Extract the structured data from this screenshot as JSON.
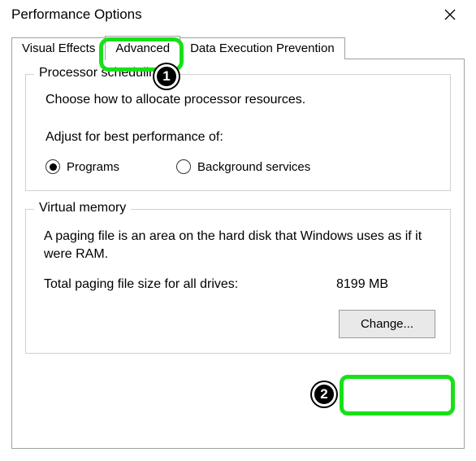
{
  "window": {
    "title": "Performance Options"
  },
  "tabs": {
    "visual_effects": "Visual Effects",
    "advanced": "Advanced",
    "dep": "Data Execution Prevention"
  },
  "processor": {
    "group_title": "Processor scheduling",
    "desc": "Choose how to allocate processor resources.",
    "adjust_label": "Adjust for best performance of:",
    "option_programs": "Programs",
    "option_background": "Background services"
  },
  "virtual_memory": {
    "group_title": "Virtual memory",
    "desc": "A paging file is an area on the hard disk that Windows uses as if it were RAM.",
    "total_label": "Total paging file size for all drives:",
    "total_value": "8199 MB",
    "change_button": "Change..."
  },
  "annotations": {
    "step1": "1",
    "step2": "2"
  }
}
